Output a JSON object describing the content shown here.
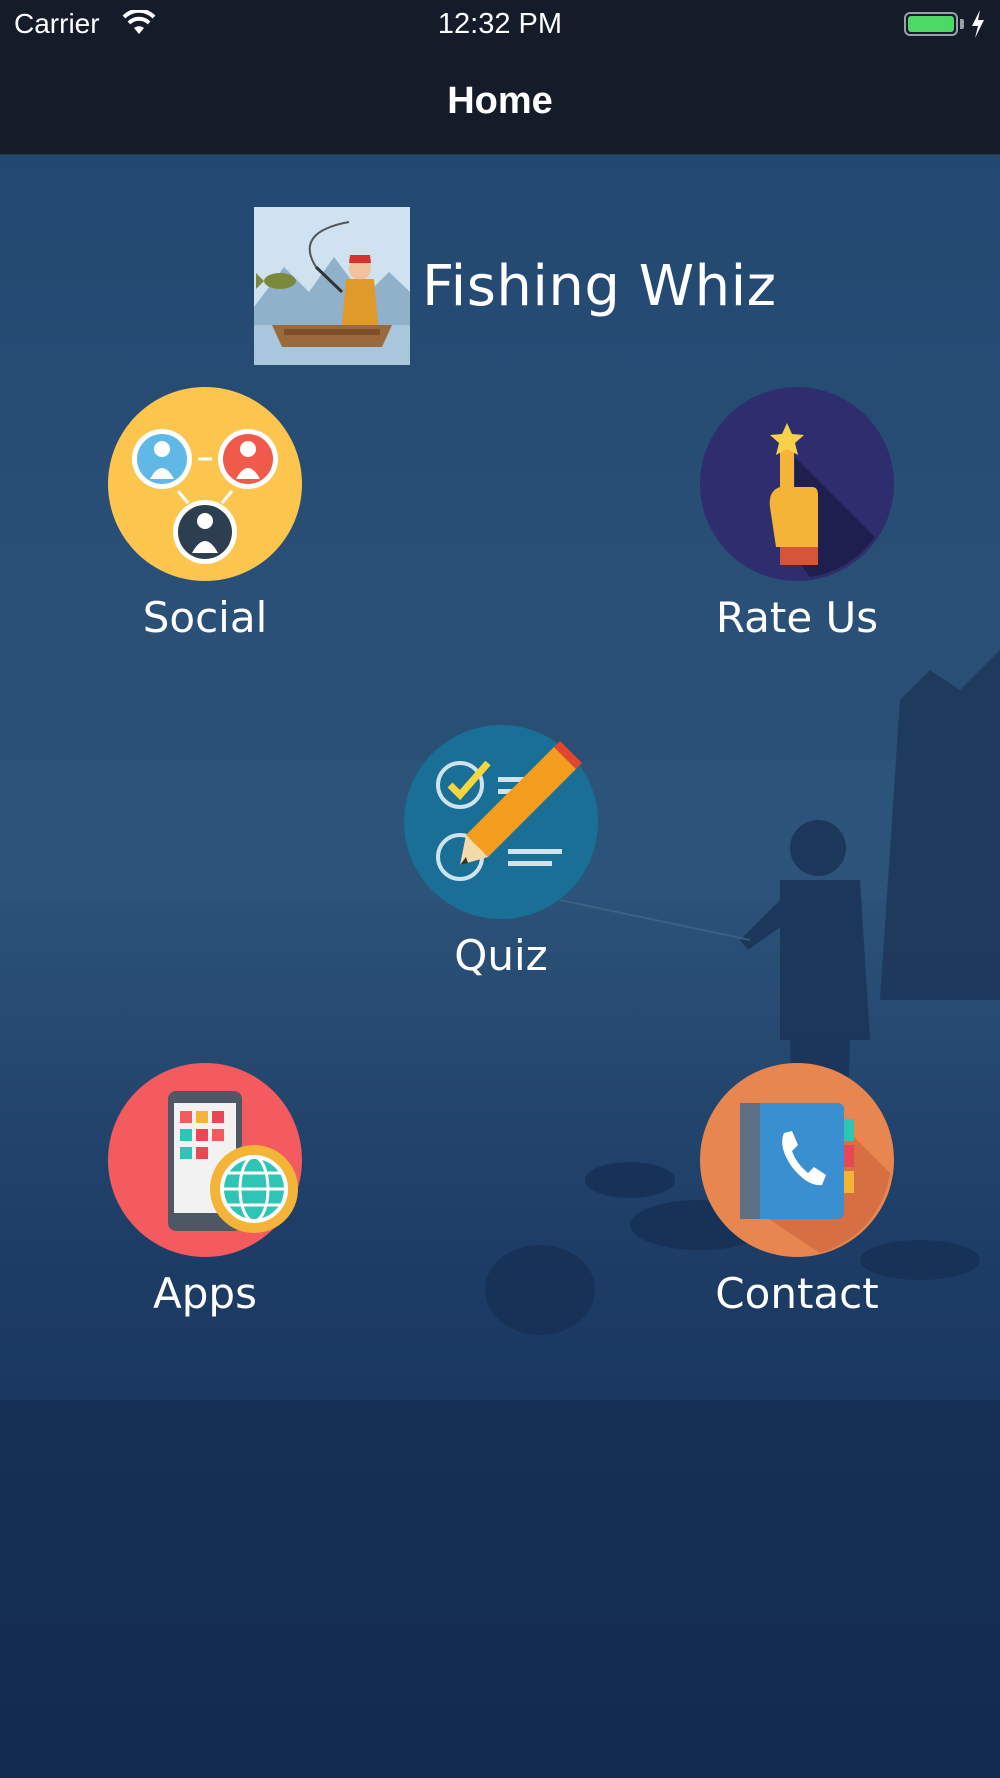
{
  "status_bar": {
    "carrier": "Carrier",
    "time": "12:32 PM",
    "icons": [
      "wifi-icon",
      "battery-icon",
      "charging-bolt-icon"
    ]
  },
  "nav": {
    "title": "Home"
  },
  "app": {
    "name": "Fishing Whiz"
  },
  "tiles": [
    {
      "label": "Social",
      "icon": "social-users-icon",
      "color": "#fcc54d"
    },
    {
      "label": "Rate Us",
      "icon": "rate-star-hand-icon",
      "color": "#2e2e6e"
    },
    {
      "label": "Quiz",
      "icon": "quiz-checklist-pencil-icon",
      "color": "#1a6f97"
    },
    {
      "label": "Apps",
      "icon": "apps-phone-globe-icon",
      "color": "#f35b5e"
    },
    {
      "label": "Contact",
      "icon": "contact-phonebook-icon",
      "color": "#e8864f"
    }
  ]
}
